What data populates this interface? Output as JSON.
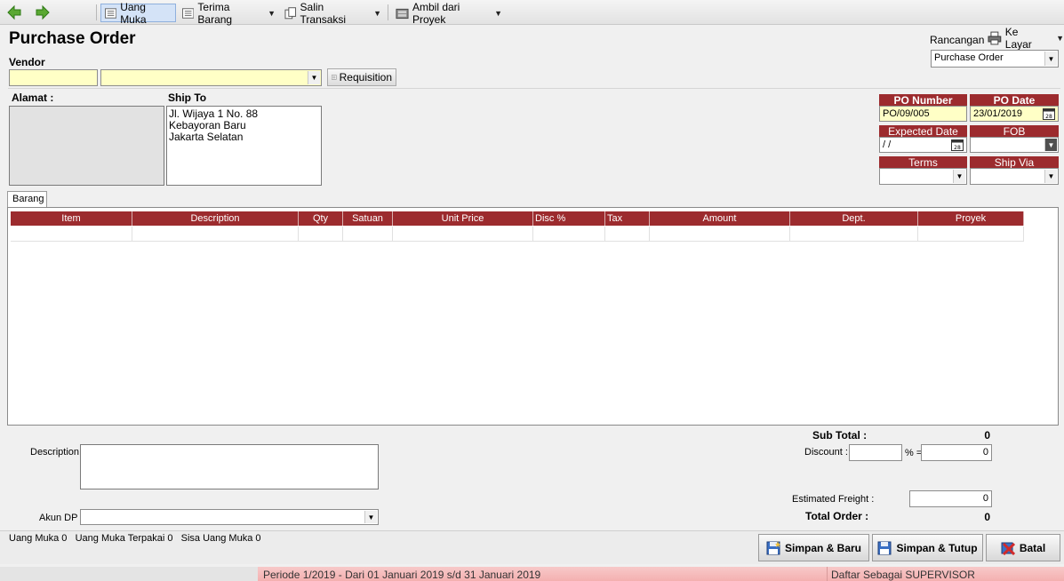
{
  "toolbar": {
    "uang_muka": "Uang Muka",
    "terima_barang": "Terima Barang",
    "salin_transaksi": "Salin Transaksi",
    "ambil_dari_proyek": "Ambil dari Proyek"
  },
  "header": {
    "title": "Purchase Order",
    "vendor_label": "Vendor",
    "vendor_code": "",
    "vendor_name": "",
    "requisition_label": "Requisition",
    "rancangan_label": "Rancangan",
    "ke_layar_label": "Ke Layar",
    "template_value": "Purchase Order"
  },
  "address": {
    "alamat_label": "Alamat :",
    "ship_to_label": "Ship To",
    "ship_to_lines": [
      "Jl. Wijaya 1 No. 88",
      "Kebayoran Baru",
      "Jakarta Selatan"
    ]
  },
  "po_info": {
    "po_number_label": "PO Number",
    "po_number": "PO/09/005",
    "po_date_label": "PO Date",
    "po_date": "23/01/2019",
    "expected_date_label": "Expected Date",
    "expected_date": " /  /",
    "fob_label": "FOB",
    "fob_value": "",
    "terms_label": "Terms",
    "terms_value": "",
    "ship_via_label": "Ship Via",
    "ship_via_value": ""
  },
  "tabs": {
    "barang": "Barang"
  },
  "grid": {
    "columns": [
      "Item",
      "Description",
      "Qty",
      "Satuan",
      "Unit Price",
      "Disc %",
      "Tax",
      "Amount",
      "Dept.",
      "Proyek"
    ]
  },
  "footer": {
    "description_label": "Description",
    "description_value": "",
    "akun_dp_label": "Akun DP",
    "akun_dp_value": "",
    "sub_total_label": "Sub Total :",
    "sub_total": "0",
    "discount_label": "Discount :",
    "discount_percent": "",
    "percent_eq": "% =",
    "discount_value": "0",
    "estimated_freight_label": "Estimated Freight :",
    "estimated_freight": "0",
    "total_order_label": "Total Order :",
    "total_order": "0",
    "uang_muka_summary": "Uang Muka 0   Uang Muka Terpakai 0   Sisa Uang Muka 0"
  },
  "buttons": {
    "simpan_baru": "Simpan & Baru",
    "simpan_tutup": "Simpan & Tutup",
    "batal": "Batal"
  },
  "status": {
    "period": "Periode 1/2019 - Dari 01 Januari 2019 s/d 31 Januari 2019",
    "user": "Daftar Sebagai SUPERVISOR"
  },
  "colors": {
    "header_red": "#9c2b2e",
    "required_yellow": "#ffffc6",
    "status_pink": "#f4b0b0"
  }
}
